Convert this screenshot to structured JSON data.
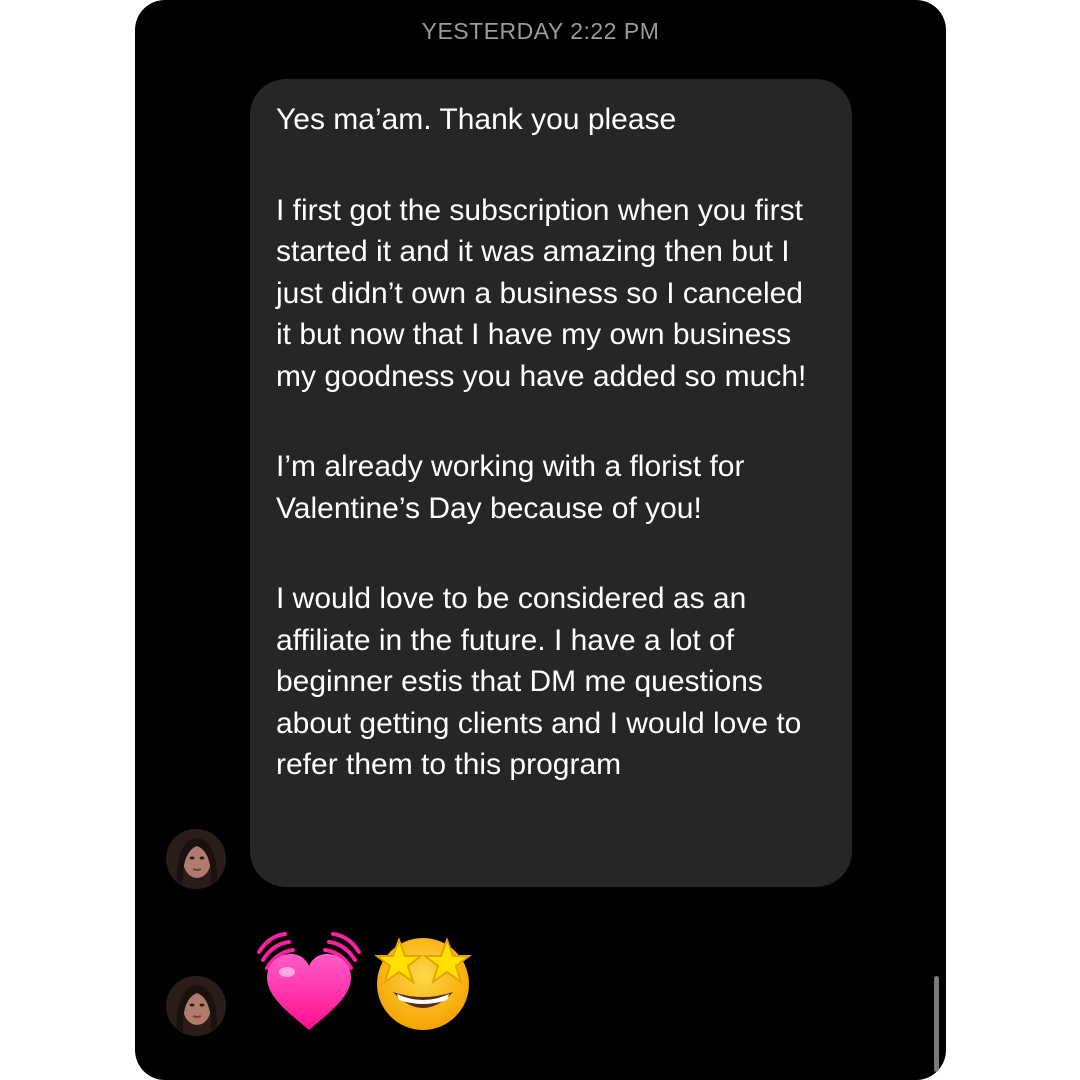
{
  "conversation": {
    "timestamp": "YESTERDAY 2:22 PM",
    "message": {
      "paragraphs": [
        "Yes ma’am. Thank you please",
        "I first got the subscription when you first started it and it was amazing then but I just didn’t own a business so I canceled it but now that I have my own business my goodness you have added so much!",
        "I’m already working with a florist for Valentine’s Day because of you!",
        "I would love to be considered as an affiliate in the future. I have a lot of beginner estis that DM me questions about getting clients and I would love to refer them to this program"
      ]
    },
    "reactions": [
      "beating-heart-emoji",
      "star-struck-emoji"
    ]
  },
  "colors": {
    "background": "#000000",
    "bubble": "#262626",
    "text": "#ffffff",
    "timestamp": "#9a9a9f",
    "heart": "#ff1493",
    "star": "#ffcc00"
  }
}
